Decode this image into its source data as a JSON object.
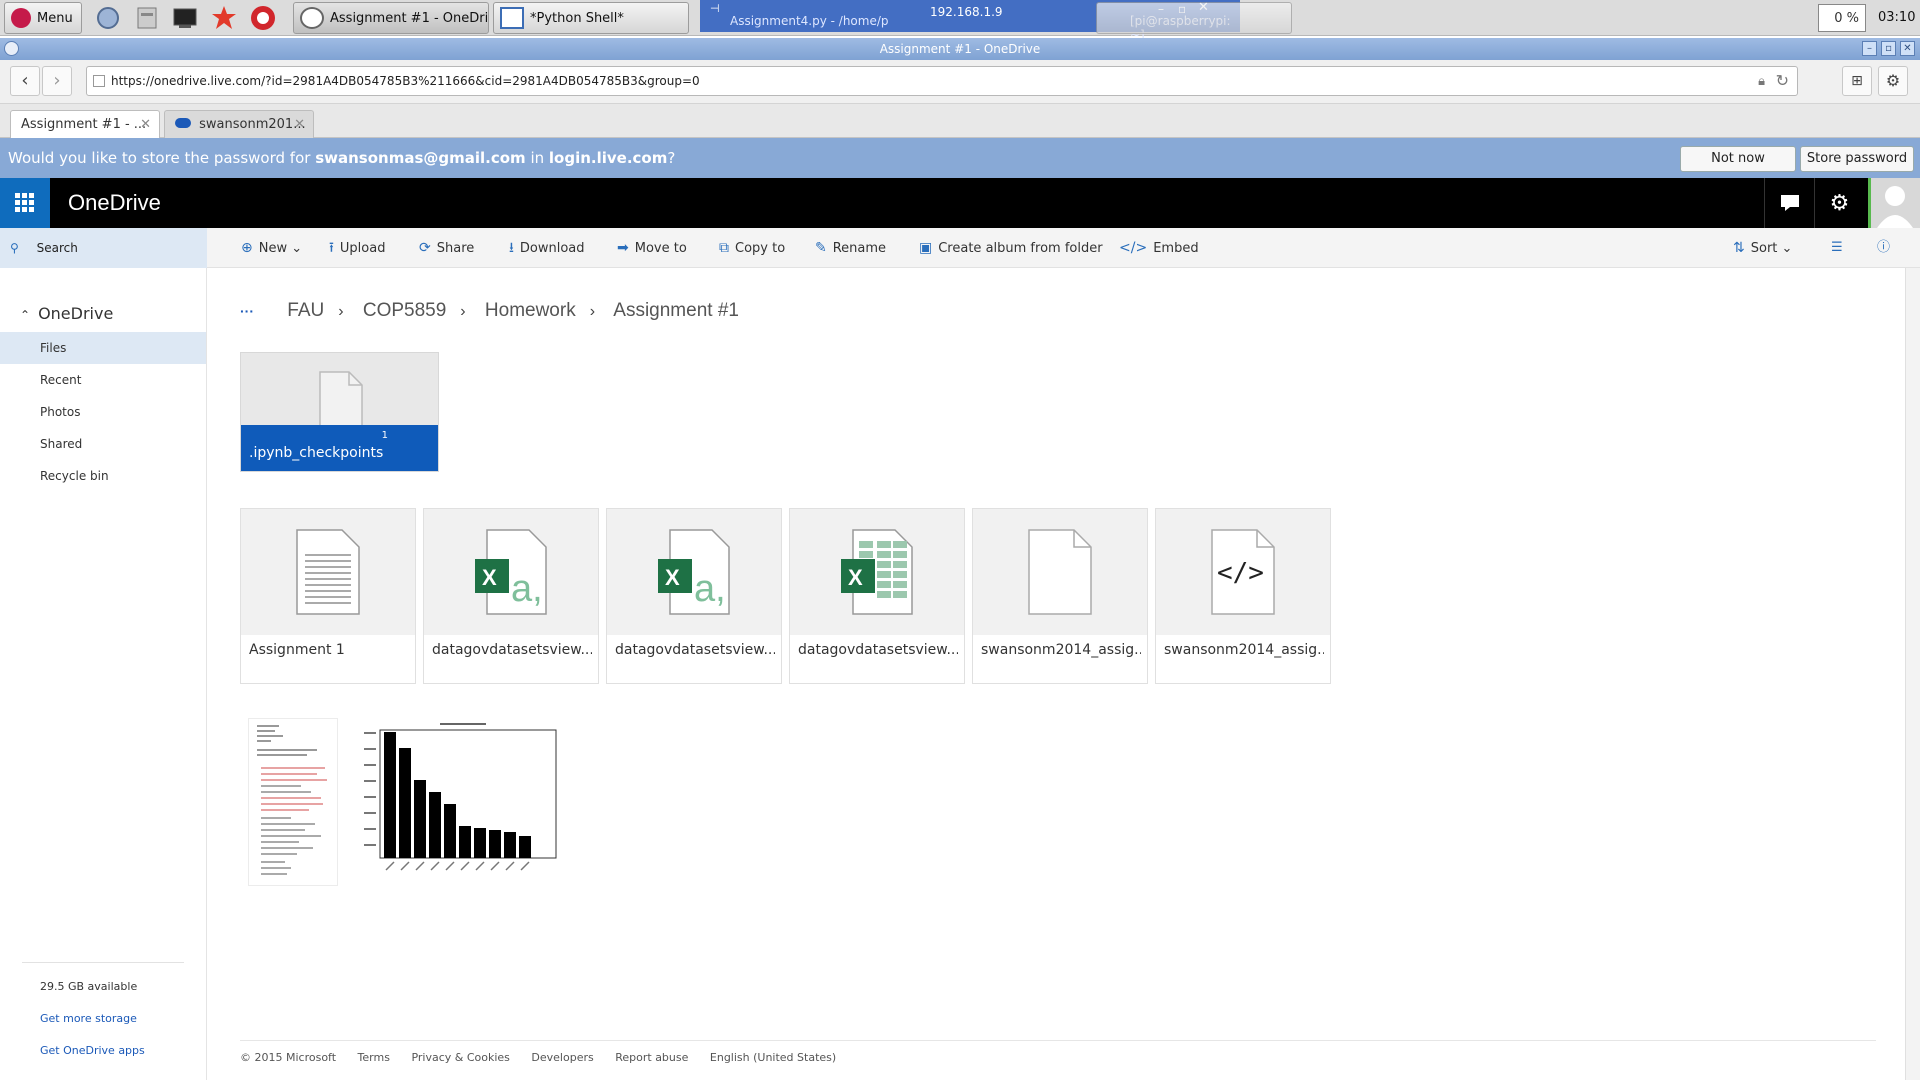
{
  "taskbar": {
    "menu_label": "Menu",
    "tasks": [
      "Assignment #1 - OneDrive",
      "*Python Shell*"
    ],
    "ghost_title": "192.168.1.9",
    "ghost_tasks": [
      "Assignment4.py - /home/p",
      "",
      "[pi@raspberrypi: ~]"
    ],
    "cpu": "0 %",
    "clock": "03:10"
  },
  "window": {
    "title": "Assignment #1 - OneDrive"
  },
  "browser": {
    "url": "https://onedrive.live.com/?id=2981A4DB054785B3%211666&cid=2981A4DB054785B3&group=0",
    "tabs": [
      {
        "label": "Assignment #1 - ..."
      },
      {
        "label": "swansonm201..."
      }
    ],
    "password_prompt": {
      "prefix": "Would you like to store the password for ",
      "email": "swansonmas@gmail.com",
      "middle": " in ",
      "site": "login.live.com",
      "suffix": "?",
      "not_now": "Not now",
      "store": "Store password"
    }
  },
  "suite": {
    "brand": "OneDrive"
  },
  "search_label": "Search",
  "commands": {
    "new": "New",
    "upload": "Upload",
    "share": "Share",
    "download": "Download",
    "move_to": "Move to",
    "copy_to": "Copy to",
    "rename": "Rename",
    "create_album": "Create album from folder",
    "embed": "Embed",
    "sort": "Sort"
  },
  "nav": {
    "heading": "OneDrive",
    "items": [
      "Files",
      "Recent",
      "Photos",
      "Shared",
      "Recycle bin"
    ],
    "storage": "29.5 GB available",
    "more_storage": "Get more storage",
    "apps": "Get OneDrive apps"
  },
  "breadcrumb": [
    "···",
    "FAU",
    "COP5859",
    "Homework",
    "Assignment #1"
  ],
  "folder": {
    "name": ".ipynb_checkpoints",
    "count": "1"
  },
  "files": [
    {
      "name": "Assignment 1",
      "icon": "document-icon"
    },
    {
      "name": "datagovdatasetsview...",
      "icon": "excel-csv-icon"
    },
    {
      "name": "datagovdatasetsview...",
      "icon": "excel-csv-icon"
    },
    {
      "name": "datagovdatasetsview...",
      "icon": "excel-sheet-icon"
    },
    {
      "name": "swansonm2014_assig...",
      "icon": "blank-file-icon"
    },
    {
      "name": "swansonm2014_assig...",
      "icon": "code-file-icon"
    }
  ],
  "footer": [
    "© 2015 Microsoft",
    "Terms",
    "Privacy & Cookies",
    "Developers",
    "Report abuse",
    "English (United States)"
  ],
  "colors": {
    "accent": "#0f5bba",
    "suite_bg": "#000000",
    "excel_green": "#1e7145",
    "password_bar": "#88a9d6"
  }
}
